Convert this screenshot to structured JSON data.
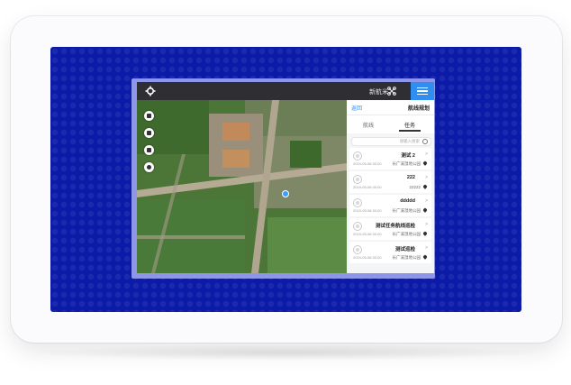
{
  "app": {
    "device_name": "新航米",
    "icons": {
      "settings": "gear-icon",
      "drone": "drone-icon",
      "menu": "hamburger-menu-icon"
    }
  },
  "map_tools": [
    {
      "name": "close-tool-icon"
    },
    {
      "name": "save-tool-icon"
    },
    {
      "name": "camera-tool-icon"
    },
    {
      "name": "record-tool-icon"
    }
  ],
  "panel": {
    "back_label": "返回",
    "title": "航线规划",
    "tabs": [
      {
        "label": "航线"
      },
      {
        "label": "任务",
        "active": true
      }
    ],
    "search_placeholder": "请输入搜索",
    "items": [
      {
        "name": "测试 2",
        "date": "2019-05-08 00:00",
        "location": "长广溪湿地公园"
      },
      {
        "name": "222",
        "date": "2019-05-08 00:00",
        "location": "22222"
      },
      {
        "name": "ddddd",
        "date": "2019-05-08 00:00",
        "location": "长广溪湿地公园"
      },
      {
        "name": "测试任务航线巡检",
        "date": "2019-05-08 00:00",
        "location": "长广溪湿地公园"
      },
      {
        "name": "测试巡检",
        "date": "2019-05-08 00:00",
        "location": "长广溪湿地公园"
      }
    ]
  },
  "colors": {
    "screen_bg": "#0c1aa8",
    "accent": "#2f8ef0",
    "topbar": "#2e2e33"
  }
}
